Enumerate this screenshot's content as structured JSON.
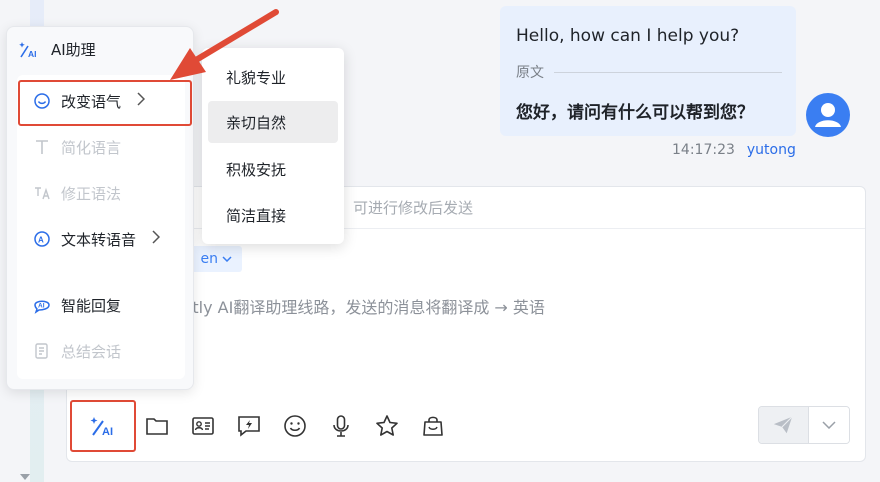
{
  "message": {
    "text": "Hello, how can I help you?",
    "original_label": "原文",
    "translated": "您好，请问有什么可以帮到您？",
    "time": "14:17:23",
    "sender": "yutong"
  },
  "compose": {
    "hint": "可进行修改后发送",
    "lang_tag": "en",
    "placeholder": "artly AI翻译助理线路，发送的消息将翻译成 → 英语"
  },
  "ai_menu": {
    "title": "AI助理",
    "items": [
      {
        "label": "改变语气",
        "enabled": true,
        "has_submenu": true,
        "icon": "chat-bubble-icon"
      },
      {
        "label": "简化语言",
        "enabled": false,
        "icon": "text-t-icon"
      },
      {
        "label": "修正语法",
        "enabled": false,
        "icon": "grammar-icon"
      },
      {
        "label": "文本转语音",
        "enabled": true,
        "has_submenu": true,
        "icon": "text-to-speech-icon"
      },
      {
        "label": "智能回复",
        "enabled": true,
        "icon": "ai-reply-icon"
      },
      {
        "label": "总结会话",
        "enabled": false,
        "icon": "summary-icon"
      }
    ]
  },
  "tone_menu": {
    "items": [
      "礼貌专业",
      "亲切自然",
      "积极安抚",
      "简洁直接"
    ],
    "hovered_index": 1
  },
  "toolbar": {
    "icons": [
      "ai-assistant-icon",
      "folder-icon",
      "contact-card-icon",
      "quick-reply-icon",
      "emoji-icon",
      "microphone-icon",
      "star-icon",
      "shopping-bag-icon"
    ]
  },
  "colors": {
    "accent": "#3a7ef2",
    "highlight_red": "#e04a36",
    "bubble_bg": "#e8f0fd"
  }
}
